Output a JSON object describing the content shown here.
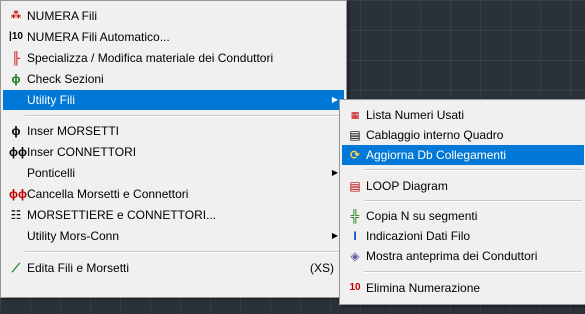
{
  "main_menu": {
    "items": [
      {
        "label": "NUMERA Fili",
        "icon": "numbering-icon",
        "color": "#c00000"
      },
      {
        "label": "NUMERA Fili Automatico...",
        "icon": "auto-numbering-icon",
        "color": "#000000"
      },
      {
        "label": "Specializza / Modifica materiale dei Conduttori",
        "icon": "wire-material-icon",
        "color": "#c00000"
      },
      {
        "label": "Check Sezioni",
        "icon": "check-sections-icon",
        "color": "#1a7a1a"
      },
      {
        "label": "Utility Fili",
        "icon": "",
        "color": ""
      },
      {
        "label": "Inser MORSETTI",
        "icon": "terminal-icon",
        "color": "#000000"
      },
      {
        "label": "Inser CONNETTORI",
        "icon": "connector-icon",
        "color": "#000000"
      },
      {
        "label": "Ponticelli",
        "icon": "",
        "color": ""
      },
      {
        "label": "Cancella Morsetti e Connettori",
        "icon": "delete-terminals-icon",
        "color": "#c00000"
      },
      {
        "label": "MORSETTIERE e CONNETTORI...",
        "icon": "terminal-block-icon",
        "color": "#000000"
      },
      {
        "label": "Utility Mors-Conn",
        "icon": "",
        "color": ""
      },
      {
        "label": "Edita Fili e Morsetti",
        "icon": "edit-wires-icon",
        "color": "#000000",
        "shortcut": "(XS)"
      }
    ]
  },
  "sub_menu": {
    "items": [
      {
        "label": "Lista Numeri Usati",
        "icon": "list-numbers-icon"
      },
      {
        "label": "Cablaggio interno Quadro",
        "icon": "panel-wiring-icon"
      },
      {
        "label": "Aggiorna Db Collegamenti",
        "icon": "update-db-icon"
      },
      {
        "label": "LOOP Diagram",
        "icon": "loop-diagram-icon"
      },
      {
        "label": "Copia N su segmenti",
        "icon": "copy-segments-icon"
      },
      {
        "label": "Indicazioni Dati Filo",
        "icon": "wire-data-icon"
      },
      {
        "label": "Mostra anteprima dei Conduttori",
        "icon": "preview-conductors-icon"
      },
      {
        "label": "Elimina Numerazione",
        "icon": "delete-numbering-icon"
      }
    ]
  },
  "colors": {
    "highlight": "#0078d7",
    "menu_bg": "#f0f0f0",
    "canvas_bg": "#2b3139"
  }
}
